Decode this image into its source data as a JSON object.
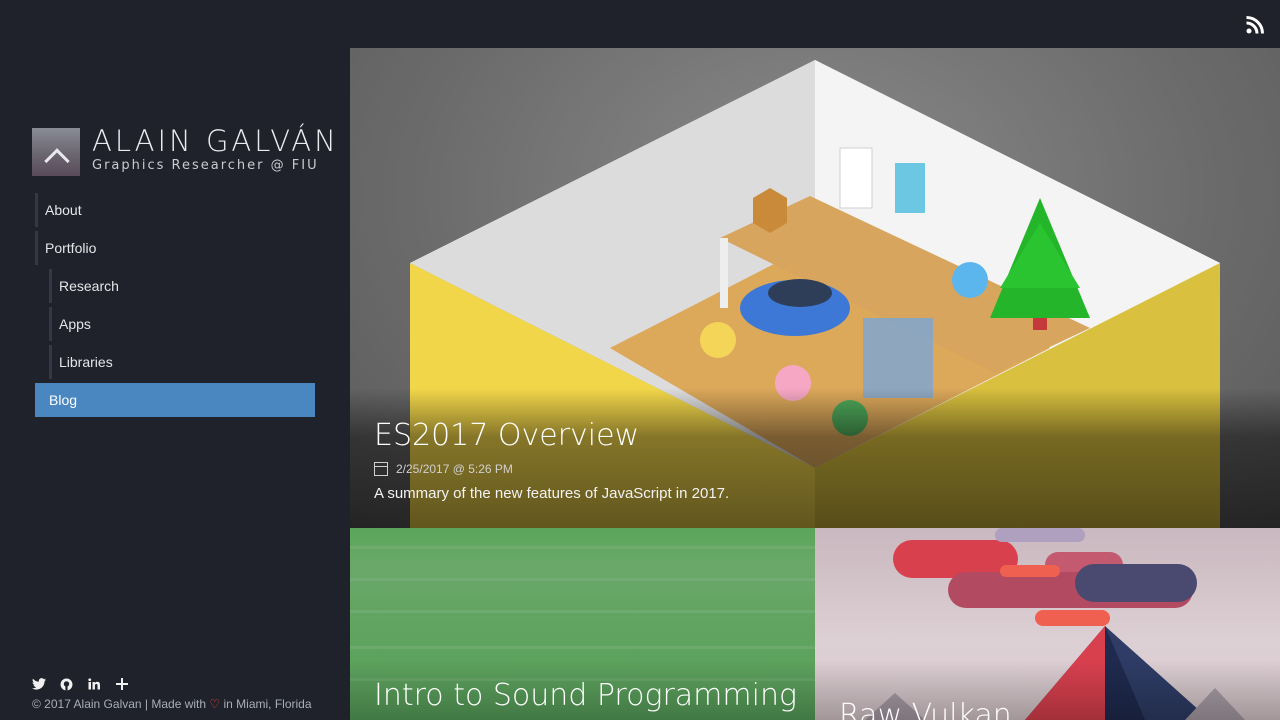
{
  "sidebar": {
    "brand_name": "ALAIN GALVÁN",
    "brand_sub": "Graphics Researcher @ FIU",
    "nav": [
      {
        "label": "About"
      },
      {
        "label": "Portfolio"
      },
      {
        "label": "Research"
      },
      {
        "label": "Apps"
      },
      {
        "label": "Libraries"
      },
      {
        "label": "Blog"
      }
    ],
    "social_icons": [
      "twitter-icon",
      "github-icon",
      "linkedin-icon",
      "plus-icon"
    ],
    "footer": {
      "prefix": "© 2017 Alain Galvan | Made with ",
      "suffix": " in Miami, Florida"
    }
  },
  "topbar": {
    "icon": "rss-icon"
  },
  "hero": {
    "title": "ES2017 Overview",
    "date": "2/25/2017 @ 5:26 PM",
    "description": "A summary of the new features of JavaScript in 2017."
  },
  "cards": [
    {
      "title": "Intro to Sound Programming"
    },
    {
      "title": "Raw Vulkan"
    }
  ],
  "colors": {
    "background": "#1f222a",
    "active_nav": "#4a86c0"
  }
}
